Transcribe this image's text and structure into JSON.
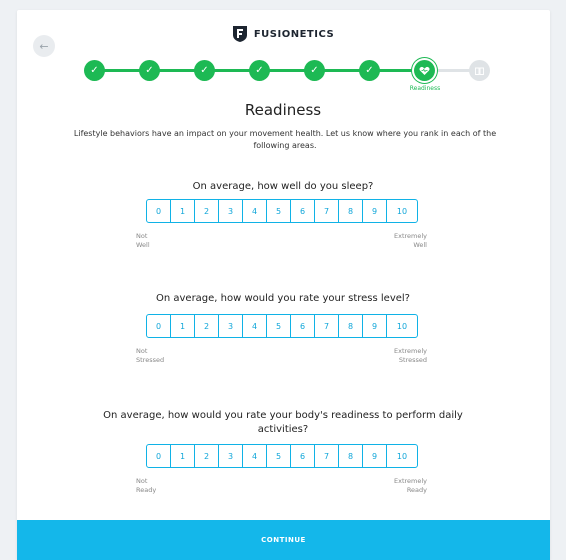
{
  "brand": {
    "name": "FUSIONETICS"
  },
  "stepper": {
    "current_caption": "Readiness",
    "completed_count": 6,
    "total": 8
  },
  "page": {
    "title": "Readiness",
    "intro": "Lifestyle behaviors have an impact on your movement health. Let us know where you rank in each of the following areas."
  },
  "questions": [
    {
      "text": "On average, how well do you sleep?",
      "options": [
        "0",
        "1",
        "2",
        "3",
        "4",
        "5",
        "6",
        "7",
        "8",
        "9",
        "10"
      ],
      "low_label": [
        "Not",
        "Well"
      ],
      "high_label": [
        "Extremely",
        "Well"
      ]
    },
    {
      "text": "On average, how would you rate your stress level?",
      "options": [
        "0",
        "1",
        "2",
        "3",
        "4",
        "5",
        "6",
        "7",
        "8",
        "9",
        "10"
      ],
      "low_label": [
        "Not",
        "Stressed"
      ],
      "high_label": [
        "Extremely",
        "Stressed"
      ]
    },
    {
      "text": "On average, how would you rate your body's readiness to perform daily activities?",
      "options": [
        "0",
        "1",
        "2",
        "3",
        "4",
        "5",
        "6",
        "7",
        "8",
        "9",
        "10"
      ],
      "low_label": [
        "Not",
        "Ready"
      ],
      "high_label": [
        "Extremely",
        "Ready"
      ]
    }
  ],
  "actions": {
    "continue_label": "CONTINUE"
  },
  "icons": {
    "back": "arrow-left-icon",
    "completed": "check-icon",
    "current": "heart-icon",
    "future": "book-icon"
  },
  "colors": {
    "accent_green": "#1db954",
    "accent_blue": "#14b7ea",
    "inactive": "#dfe3e6"
  }
}
